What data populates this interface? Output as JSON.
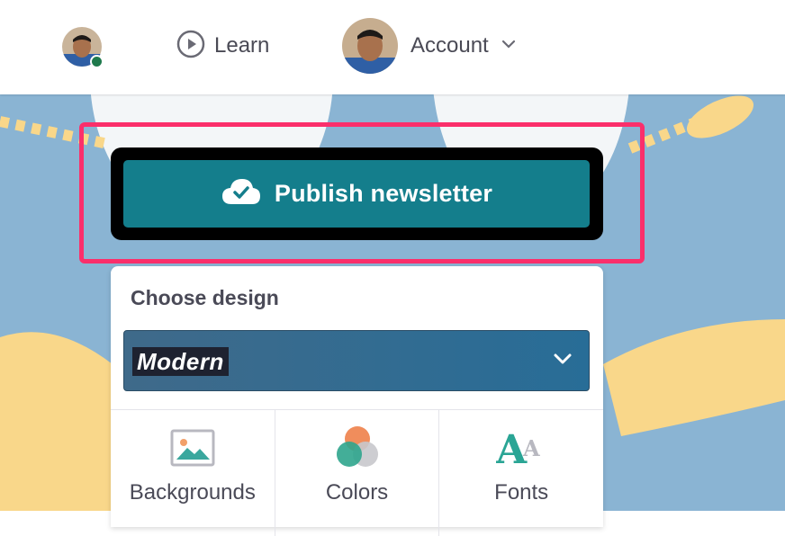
{
  "nav": {
    "learn_label": "Learn",
    "account_label": "Account"
  },
  "publish": {
    "label": "Publish newsletter"
  },
  "design_panel": {
    "title": "Choose design",
    "selected_design": "Modern",
    "tabs": [
      {
        "label": "Backgrounds",
        "icon": "image-icon"
      },
      {
        "label": "Colors",
        "icon": "color-circles-icon"
      },
      {
        "label": "Fonts",
        "icon": "font-icon"
      }
    ]
  },
  "colors": {
    "publish_button": "#147e8c",
    "highlight": "#fb2f6b",
    "online_status": "#1f7a4d",
    "background_blue": "#8ab4d3",
    "background_yellow": "#f9d78a"
  }
}
